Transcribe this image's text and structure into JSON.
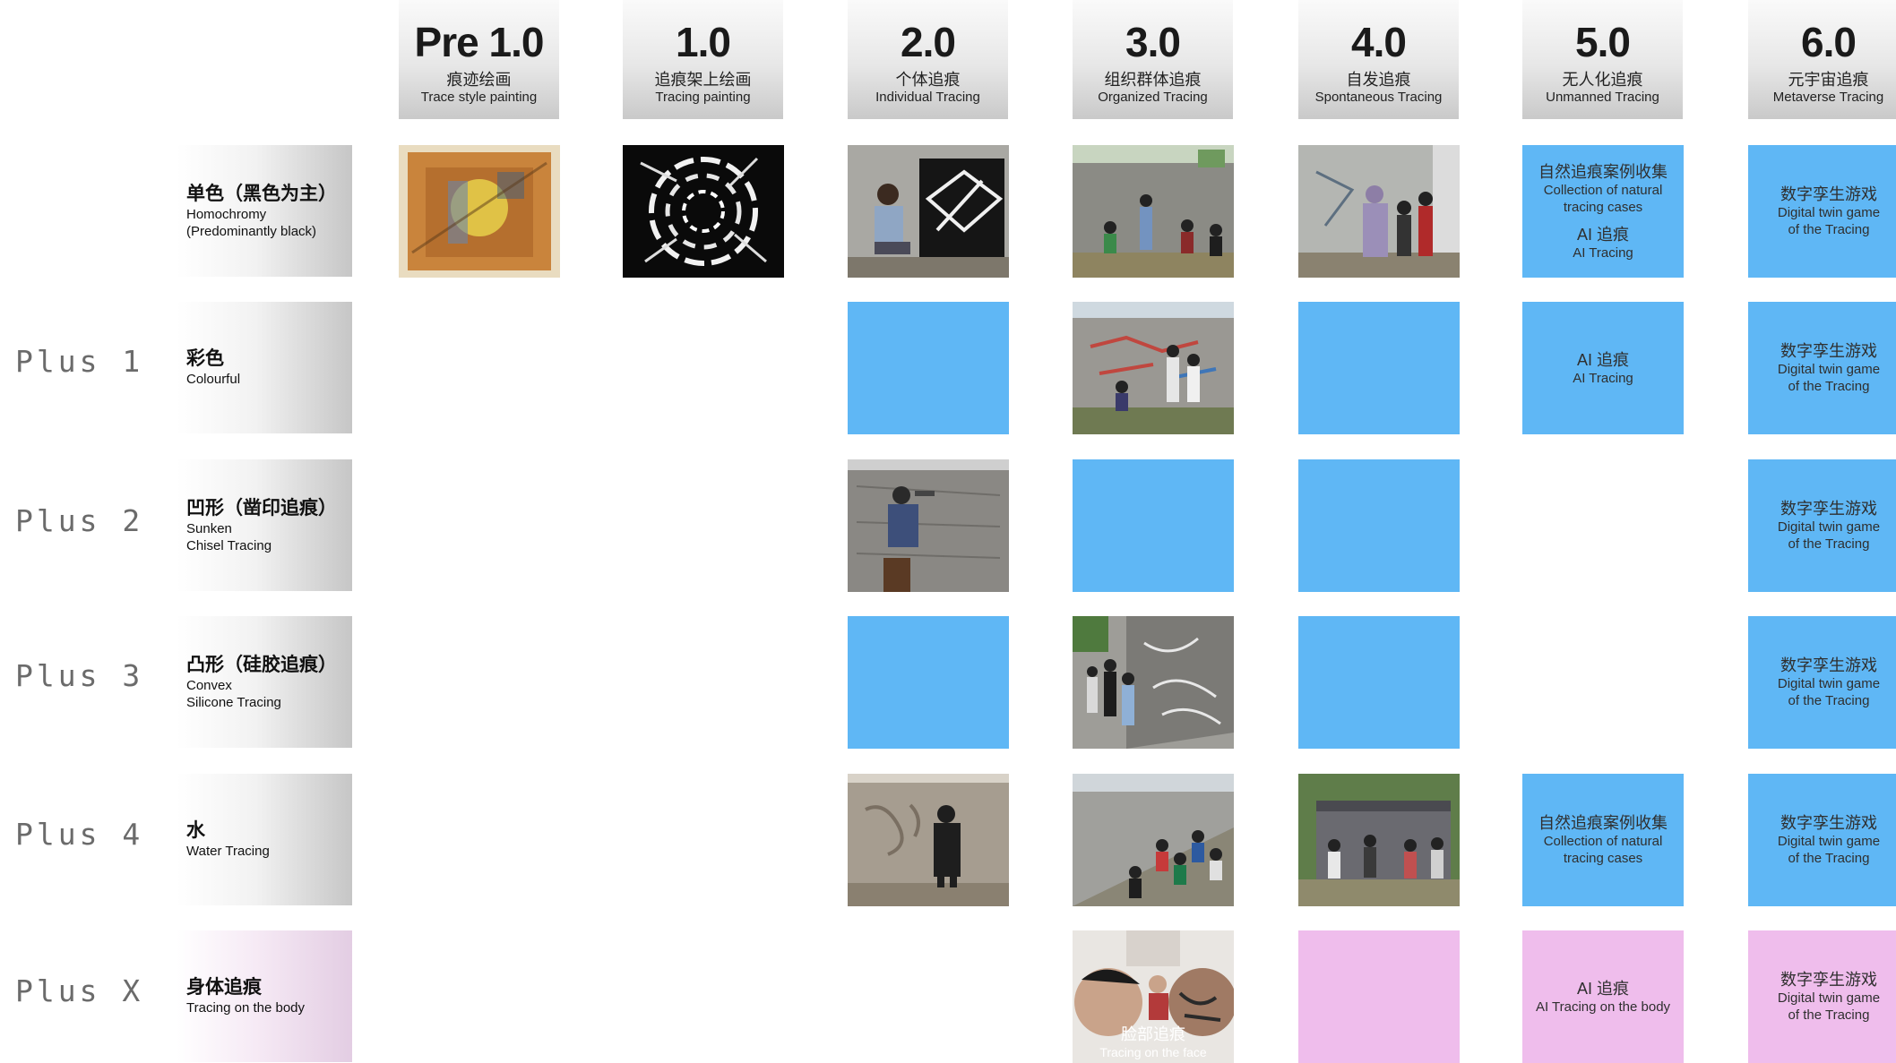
{
  "columns": [
    {
      "version": "Pre 1.0",
      "zh": "痕迹绘画",
      "en": "Trace style painting"
    },
    {
      "version": "1.0",
      "zh": "追痕架上绘画",
      "en": "Tracing painting"
    },
    {
      "version": "2.0",
      "zh": "个体追痕",
      "en": "Individual Tracing"
    },
    {
      "version": "3.0",
      "zh": "组织群体追痕",
      "en": "Organized Tracing"
    },
    {
      "version": "4.0",
      "zh": "自发追痕",
      "en": "Spontaneous Tracing"
    },
    {
      "version": "5.0",
      "zh": "无人化追痕",
      "en": "Unmanned Tracing"
    },
    {
      "version": "6.0",
      "zh": "元宇宙追痕",
      "en": "Metaverse Tracing"
    }
  ],
  "rows": [
    {
      "plus": "",
      "zh": "单色（黑色为主）",
      "en1": "Homochromy",
      "en2": "(Predominantly black)"
    },
    {
      "plus": "Plus 1",
      "zh": "彩色",
      "en1": "Colourful",
      "en2": ""
    },
    {
      "plus": "Plus 2",
      "zh": "凹形（凿印追痕）",
      "en1": "Sunken",
      "en2": "Chisel Tracing"
    },
    {
      "plus": "Plus 3",
      "zh": "凸形（硅胶追痕）",
      "en1": "Convex",
      "en2": "Silicone Tracing"
    },
    {
      "plus": "Plus 4",
      "zh": "水",
      "en1": "Water Tracing",
      "en2": ""
    },
    {
      "plus": "Plus X",
      "zh": "身体追痕",
      "en1": "Tracing on the body",
      "en2": ""
    }
  ],
  "cells": {
    "r0c5": {
      "zh1": "自然追痕案例收集",
      "en1": "Collection of natural",
      "en2": "tracing cases",
      "zh2": "AI 追痕",
      "en3": "AI Tracing"
    },
    "r0c6": {
      "zh1": "数字孪生游戏",
      "en1": "Digital twin game",
      "en2": "of the Tracing"
    },
    "r1c5": {
      "zh1": "AI 追痕",
      "en1": "AI Tracing"
    },
    "r1c6": {
      "zh1": "数字孪生游戏",
      "en1": "Digital twin game",
      "en2": "of the Tracing"
    },
    "r2c6": {
      "zh1": "数字孪生游戏",
      "en1": "Digital twin game",
      "en2": "of the Tracing"
    },
    "r3c6": {
      "zh1": "数字孪生游戏",
      "en1": "Digital twin game",
      "en2": "of the Tracing"
    },
    "r4c5": {
      "zh1": "自然追痕案例收集",
      "en1": "Collection of natural",
      "en2": "tracing cases"
    },
    "r4c6": {
      "zh1": "数字孪生游戏",
      "en1": "Digital twin game",
      "en2": "of the Tracing"
    },
    "r5c3": {
      "zh1": "脸部追痕",
      "en1": "Tracing on the face"
    },
    "r5c5": {
      "zh1": "AI 追痕",
      "en1": "AI Tracing on the body"
    },
    "r5c6": {
      "zh1": "数字孪生游戏",
      "en1": "Digital twin game",
      "en2": "of the Tracing"
    }
  },
  "colors": {
    "blue_cell": "#5fb7f5",
    "pink_cell": "#efbdec",
    "header_gray": "#d0d0d0"
  }
}
